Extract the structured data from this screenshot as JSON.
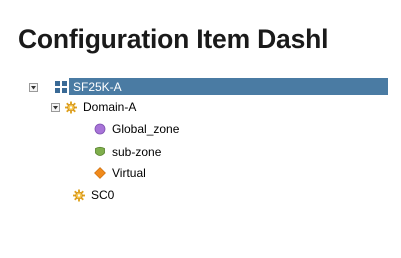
{
  "page": {
    "title": "Configuration Item Dashl"
  },
  "tree": {
    "root": {
      "label": "SF25K-A",
      "icon": "server-grid-icon",
      "expanded": true,
      "selected": true
    },
    "domain": {
      "label": "Domain-A",
      "icon": "gear-sun-icon",
      "expanded": true
    },
    "children": [
      {
        "label": "Global_zone",
        "icon": "purple-circle-icon",
        "color": "#a874d8"
      },
      {
        "label": "sub-zone",
        "icon": "green-shield-icon",
        "color": "#7fae4c"
      },
      {
        "label": "Virtual",
        "icon": "orange-diamond-icon",
        "color": "#f08a1c"
      }
    ],
    "sibling": {
      "label": "SC0",
      "icon": "gear-sun-icon"
    }
  },
  "colors": {
    "selection": "#4a7ba3",
    "gear": "#e0a21b"
  }
}
